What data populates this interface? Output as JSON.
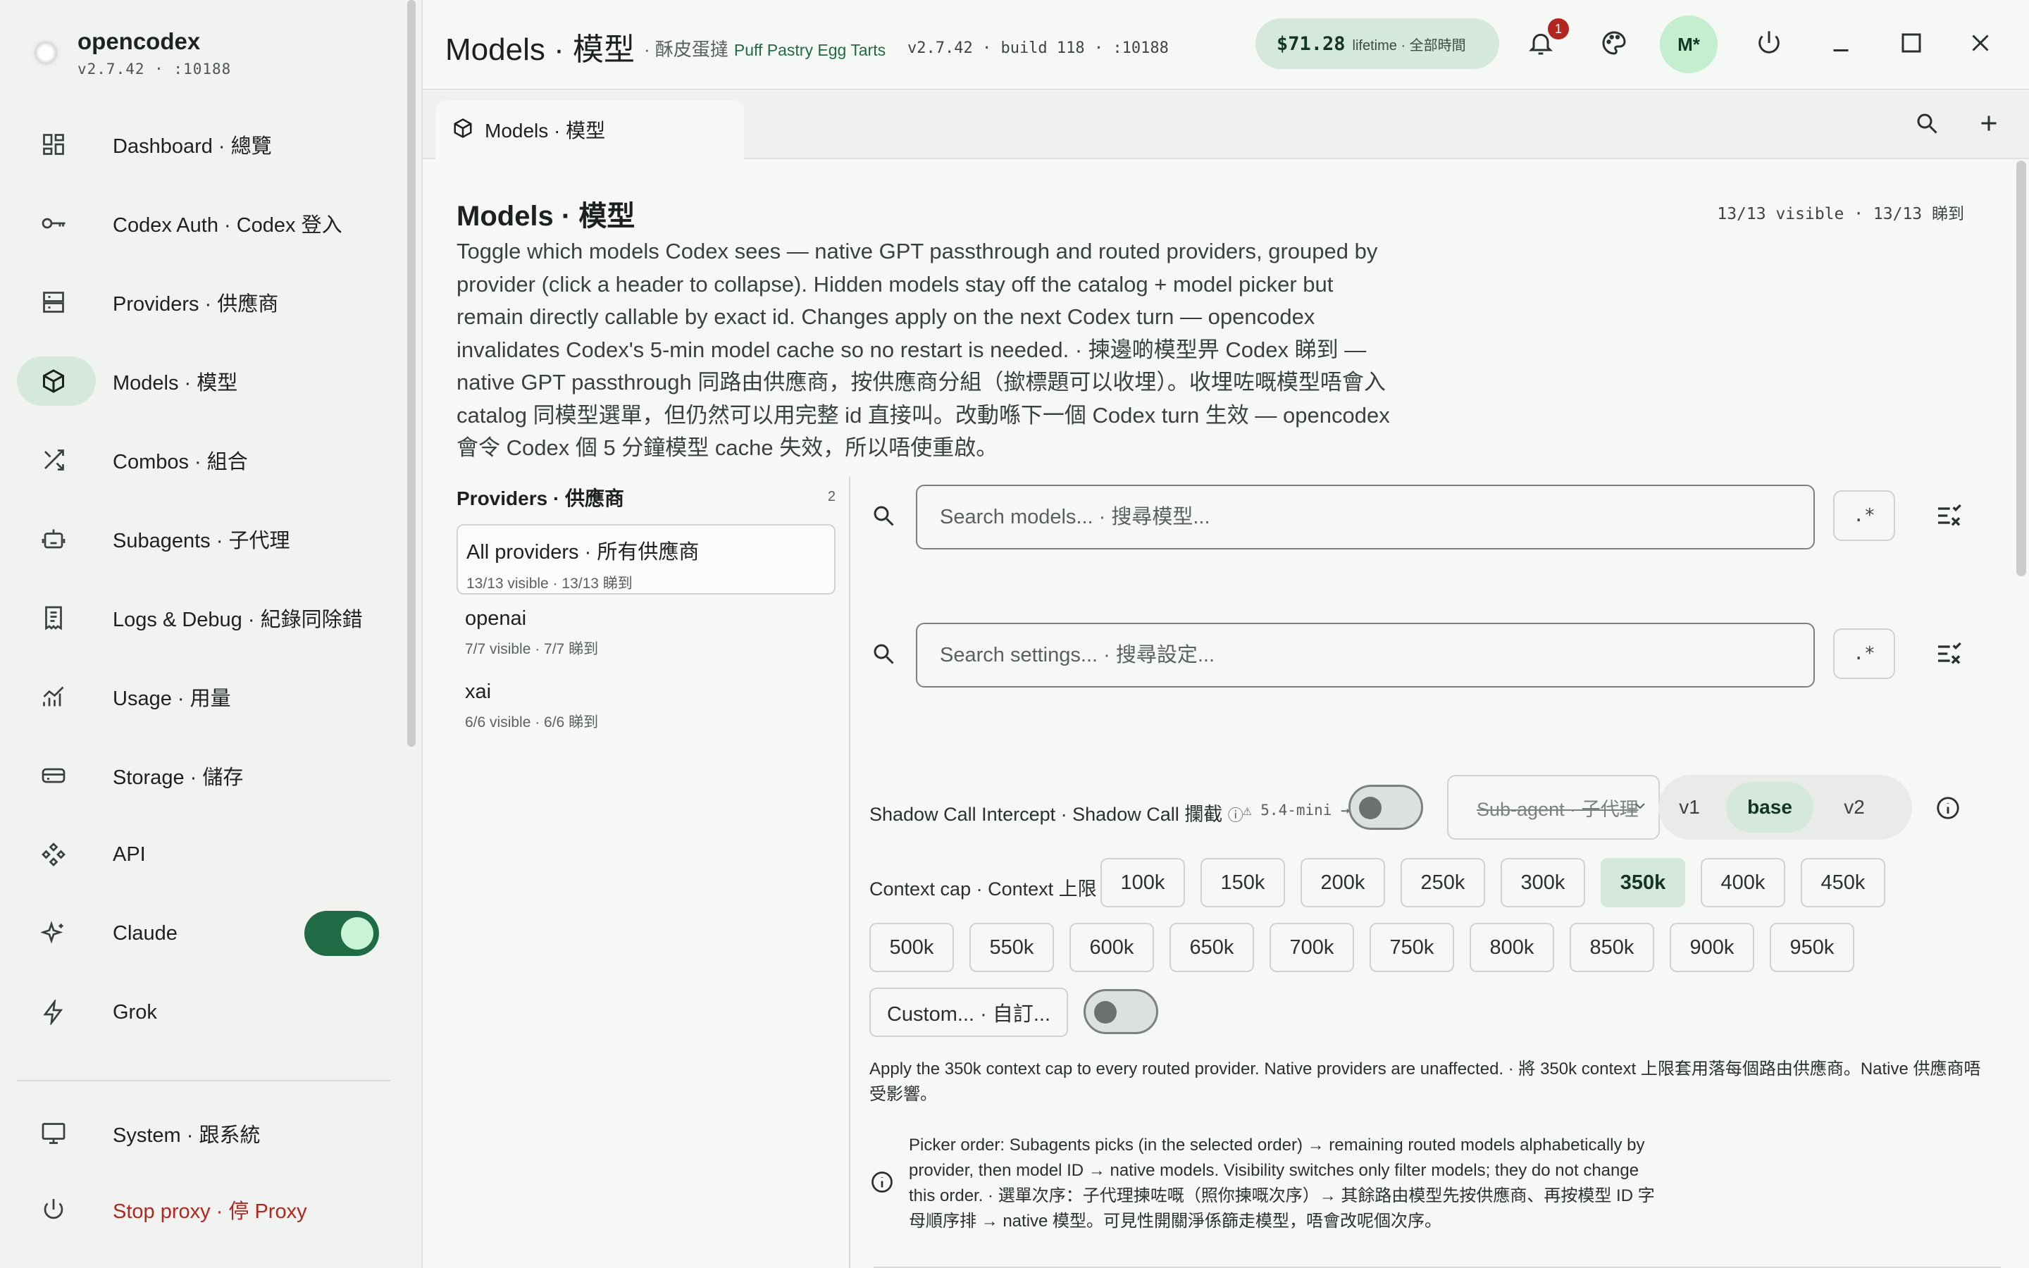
{
  "app": {
    "name": "opencodex",
    "version_line": "v2.7.42 · :10188"
  },
  "sidebar": {
    "items": [
      {
        "label": "Dashboard · 總覽",
        "icon": "dashboard-icon"
      },
      {
        "label": "Codex Auth · Codex 登入",
        "icon": "key-icon"
      },
      {
        "label": "Providers · 供應商",
        "icon": "server-icon"
      },
      {
        "label": "Models · 模型",
        "icon": "cube-icon",
        "active": true
      },
      {
        "label": "Combos · 組合",
        "icon": "shuffle-icon"
      },
      {
        "label": "Subagents · 子代理",
        "icon": "robot-icon"
      },
      {
        "label": "Logs & Debug · 紀錄同除錯",
        "icon": "receipt-icon"
      },
      {
        "label": "Usage · 用量",
        "icon": "chart-icon"
      },
      {
        "label": "Storage · 儲存",
        "icon": "storage-icon"
      },
      {
        "label": "API",
        "icon": "api-icon"
      },
      {
        "label": "Claude",
        "icon": "sparkle-icon",
        "toggle": true
      },
      {
        "label": "Grok",
        "icon": "bolt-icon"
      }
    ],
    "system_label": "System · 跟系統",
    "stop_label": "Stop proxy · 停 Proxy"
  },
  "header": {
    "title": "Models · 模型",
    "subtitle_zh": "· 酥皮蛋撻",
    "subtitle_en": "Puff Pastry Egg Tarts",
    "version": "v2.7.42 · build 118 · :10188",
    "cost_amount": "$71.28",
    "cost_label": "lifetime · 全部時間",
    "notification_count": "1",
    "avatar": "M*"
  },
  "tab": {
    "label": "Models · 模型"
  },
  "page": {
    "title": "Models · 模型",
    "count": "13/13 visible · 13/13 睇到",
    "description": "Toggle which models Codex sees — native GPT passthrough and routed providers, grouped by provider (click a header to collapse). Hidden models stay off the catalog + model picker but remain directly callable by exact id. Changes apply on the next Codex turn — opencodex invalidates Codex's 5-min model cache so no restart is needed. · 揀邊啲模型畀 Codex 睇到 — native GPT passthrough 同路由供應商，按供應商分組（撳標題可以收埋）。收埋咗嘅模型唔會入 catalog 同模型選單，但仍然可以用完整 id 直接叫。改動喺下一個 Codex turn 生效 — opencodex 會令 Codex 個 5 分鐘模型 cache 失效，所以唔使重啟。"
  },
  "providers": {
    "title": "Providers · 供應商",
    "count": "2",
    "items": [
      {
        "name": "All providers · 所有供應商",
        "sub": "13/13 visible · 13/13 睇到"
      },
      {
        "name": "openai",
        "sub": "7/7 visible · 7/7 睇到"
      },
      {
        "name": "xai",
        "sub": "6/6 visible · 6/6 睇到"
      }
    ]
  },
  "search_models": {
    "placeholder": "Search models... · 搜尋模型...",
    "regex": ".*"
  },
  "search_settings": {
    "placeholder": "Search settings... · 搜尋設定...",
    "regex": ".*"
  },
  "shadow": {
    "label": "Shadow Call Intercept · Shadow Call 攔截",
    "warning": "⚠ 5.4-mini →",
    "subagent_select": "Sub-agent · 子代理",
    "versions": [
      "v1",
      "base",
      "v2"
    ],
    "selected_version": "base"
  },
  "context": {
    "label": "Context cap · Context 上限",
    "options": [
      "100k",
      "150k",
      "200k",
      "250k",
      "300k",
      "350k",
      "400k",
      "450k",
      "500k",
      "550k",
      "600k",
      "650k",
      "700k",
      "750k",
      "800k",
      "850k",
      "900k",
      "950k"
    ],
    "selected": "350k",
    "custom_label": "Custom... · 自訂...",
    "apply_note": "Apply the 350k context cap to every routed provider. Native providers are unaffected. · 將 350k context 上限套用落每個路由供應商。Native 供應商唔受影響。"
  },
  "picker_note": "Picker order: Subagents picks (in the selected order) → remaining routed models alphabetically by provider, then model ID → native models. Visibility switches only filter models; they do not change this order. · 選單次序：子代理揀咗嘅（照你揀嘅次序）→ 其餘路由模型先按供應商、再按模型 ID 字母順序排 → native 模型。可見性開關淨係篩走模型，唔會改呢個次序。",
  "colors": {
    "accent": "#1f6b45",
    "accent_soft": "#d5e8dc",
    "danger": "#b3261e"
  }
}
